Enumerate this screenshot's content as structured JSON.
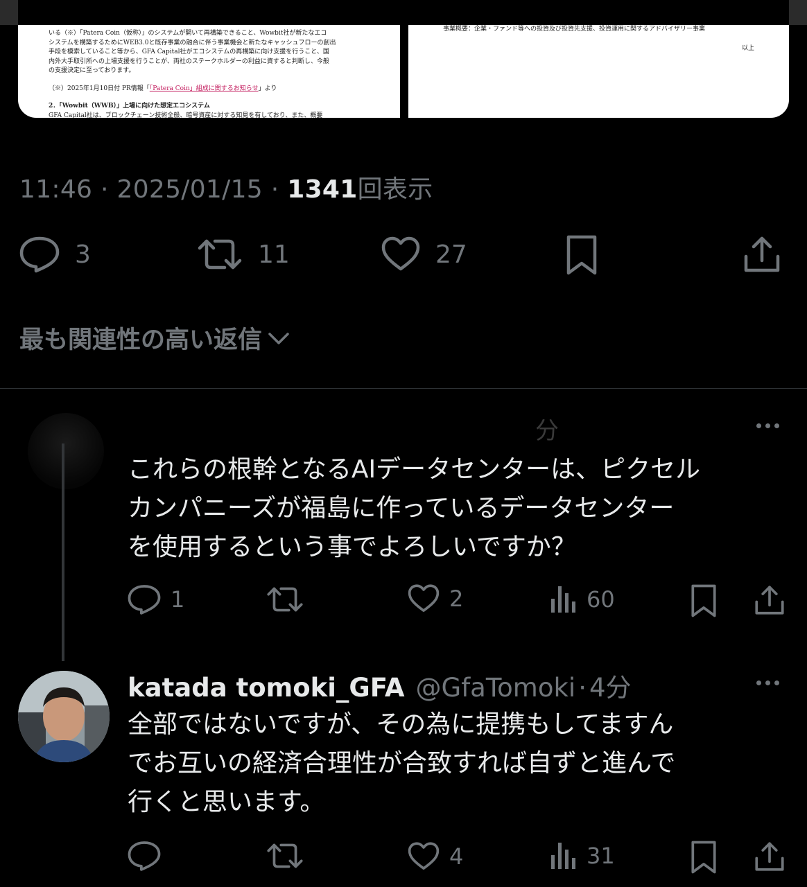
{
  "attached_images": {
    "left_doc_lines": [
      "いる（※）「Patera Coin（仮称）」のシステムが開いて再構築できること、Wowbit社が新たなエコ",
      "システムを構築するためにWEB3.0と既存事業の融合に伴う事業機会と新たなキャッシュフローの創出",
      "手段を模索していること等から、GFA Capital社がエコシステムの再構築に向け支援を行うこと、国",
      "内外大手取引所への上場支援を行うことが、両社のステークホルダーの利益に資すると判断し、今般",
      "の支援決定に至っております。"
    ],
    "left_doc_note_prefix": "（※）2025年1月10日付 PR情報「",
    "left_doc_note_link": "「Patera Coin」組成に関するお知らせ",
    "left_doc_note_suffix": "」より",
    "left_doc_section": "2．「Wowbit（WWB）」上場に向けた想定エコシステム",
    "left_doc_tail": "GFA Capital社は、ブロックチェーン技術全般、暗号資産に対する知見を有しており、また、概要",
    "right_doc_line": "事業概要：企業・ファンド等への投資及び投資先支援、投資運用に関するアドバイザリー事業",
    "right_doc_end": "以上"
  },
  "main_tweet": {
    "time": "11:46",
    "date": "2025/01/15",
    "views": "1341",
    "views_label": "回表示",
    "separator": " · ",
    "replies": "3",
    "reposts": "11",
    "likes": "27"
  },
  "relevance_label": "最も関連性の高い返信",
  "reply1": {
    "time_fragment": "分",
    "text_lines": [
      "これらの根幹となるAIデータセンターは、ピクセル",
      "カンパニーズが福島に作っているデータセンター",
      "を使用するという事でよろしいですか？"
    ],
    "replies": "1",
    "reposts": "",
    "likes": "2",
    "views": "60"
  },
  "reply2": {
    "name": "katada tomoki_GFA",
    "handle": "@GfaTomoki",
    "separator": "·",
    "time": "4分",
    "text_lines": [
      "全部ではないですが、その為に提携もしてますん",
      "でお互いの経済合理性が合致すれば自ずと進んで",
      "行くと思います。"
    ],
    "replies": "",
    "reposts": "",
    "likes": "4",
    "views": "31"
  },
  "colors": {
    "background": "#000000",
    "text": "#e7e9ea",
    "muted": "#71767b"
  },
  "icons": [
    "reply-icon",
    "repost-icon",
    "like-icon",
    "bookmark-icon",
    "share-icon",
    "views-icon",
    "more-icon",
    "chevron-down-icon"
  ]
}
